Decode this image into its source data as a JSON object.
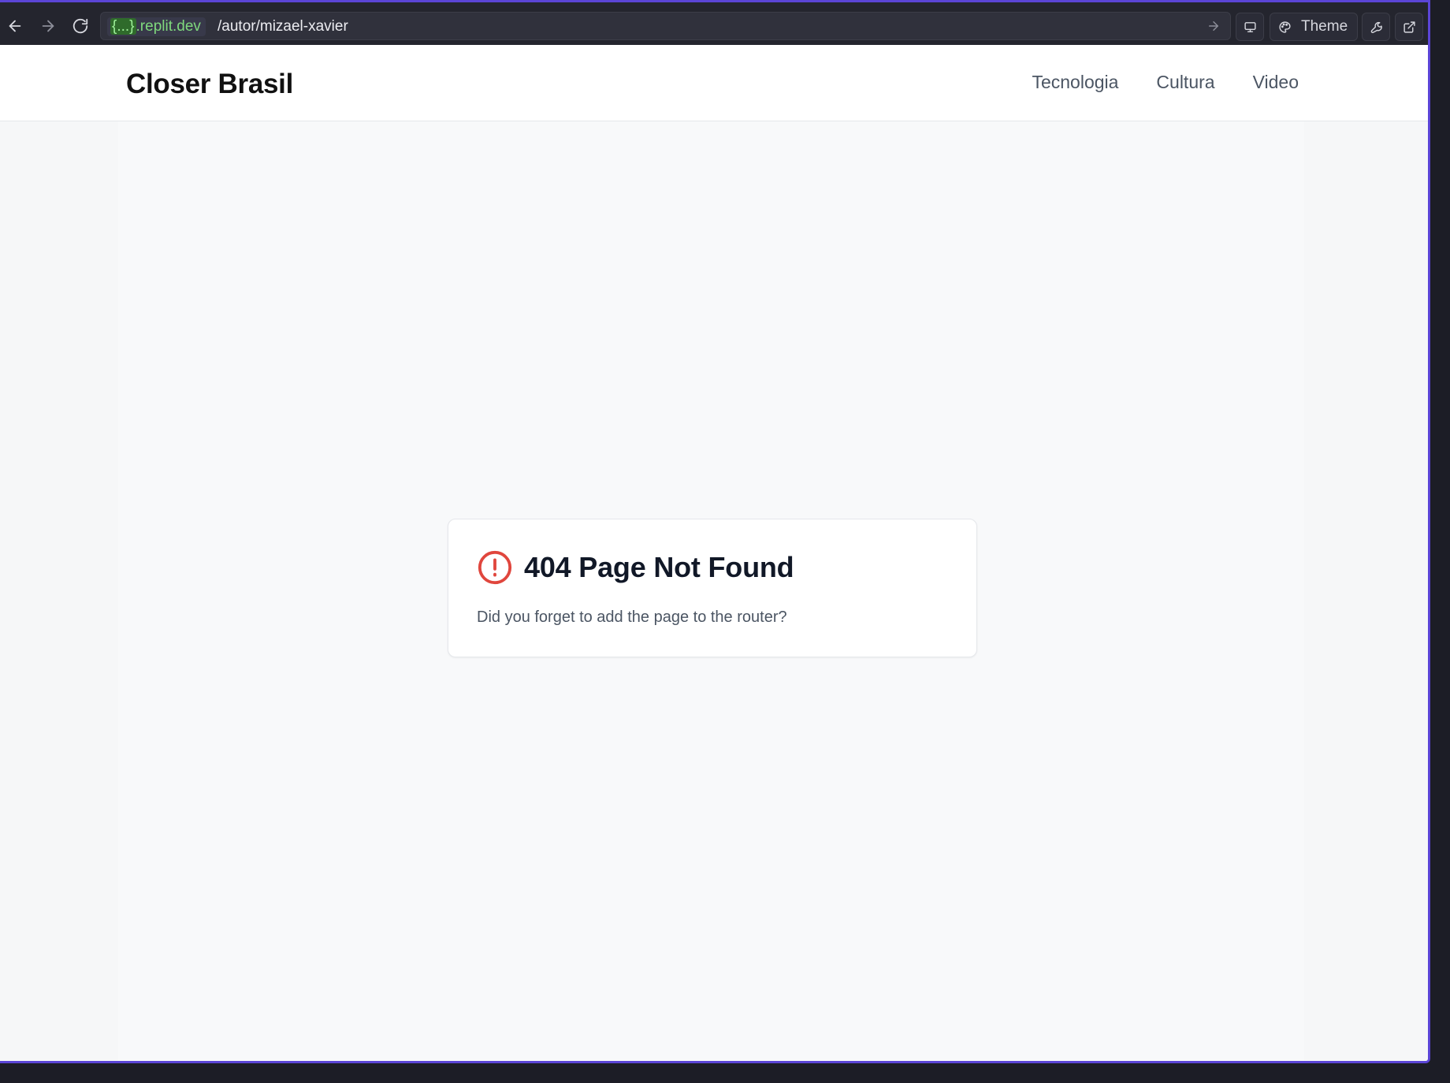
{
  "browser": {
    "url_host_braces": "{...}",
    "url_host": ".replit.dev",
    "url_path": "/autor/mizael-xavier",
    "theme_label": "Theme",
    "accent_color": "#5b45d6"
  },
  "site": {
    "brand": "Closer Brasil",
    "nav": [
      "Tecnologia",
      "Cultura",
      "Video"
    ]
  },
  "error": {
    "title": "404 Page Not Found",
    "message": "Did you forget to add the page to the router?",
    "icon": "alert-circle-icon",
    "icon_color": "#e0463d"
  }
}
